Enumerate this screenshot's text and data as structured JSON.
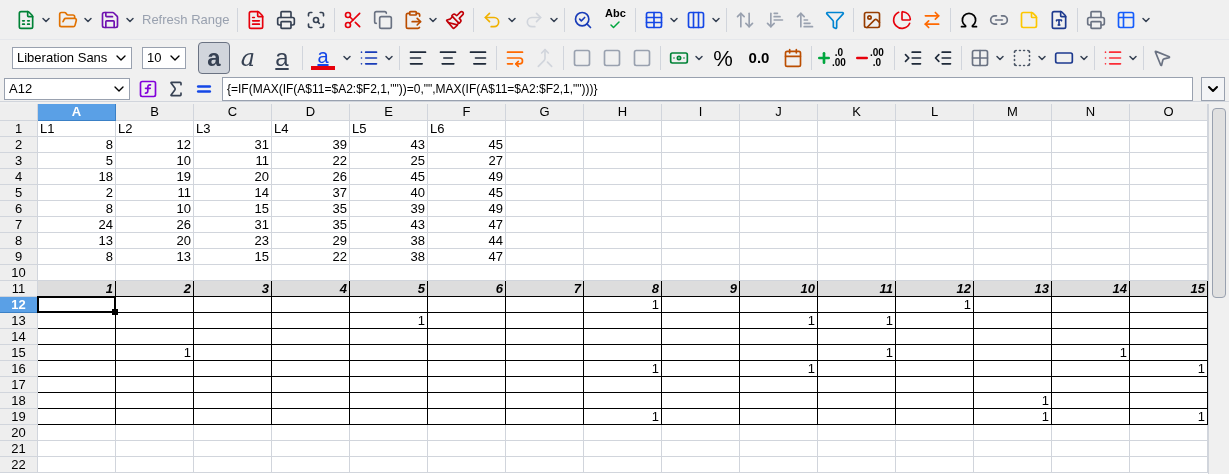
{
  "toolbar": {
    "refresh_range": {
      "label": "Refresh Range",
      "disabled": true
    },
    "spellcheck_label": "Abc",
    "percent": "%",
    "decimal": "0.0",
    "add_decimal": [
      ".0",
      ".00"
    ],
    "delete_decimal": [
      ".00",
      ".0"
    ]
  },
  "formatting": {
    "font_name": "Liberation Sans",
    "font_size": "10",
    "font_color_label": "a",
    "styles": [
      {
        "label": "a",
        "kind": "bold",
        "selected": true
      },
      {
        "label": "a",
        "kind": "italic",
        "selected": false
      },
      {
        "label": "a",
        "kind": "underline",
        "selected": false
      }
    ]
  },
  "formula_bar": {
    "name_box": "A12",
    "formula": "{=IF(MAX(IF(A$11=$A2:$F2,1,\"\"))=0,\"\",MAX(IF(A$11=$A2:$F2,1,\"\")))}"
  },
  "sheet": {
    "columns": [
      {
        "label": "A",
        "selected": true
      },
      {
        "label": "B",
        "selected": false
      },
      {
        "label": "C",
        "selected": false
      },
      {
        "label": "D",
        "selected": false
      },
      {
        "label": "E",
        "selected": false
      },
      {
        "label": "F",
        "selected": false
      },
      {
        "label": "G",
        "selected": false
      },
      {
        "label": "H",
        "selected": false
      },
      {
        "label": "I",
        "selected": false
      },
      {
        "label": "J",
        "selected": false
      },
      {
        "label": "K",
        "selected": false
      },
      {
        "label": "L",
        "selected": false
      },
      {
        "label": "M",
        "selected": false
      },
      {
        "label": "N",
        "selected": false
      },
      {
        "label": "O",
        "selected": false
      }
    ],
    "rows": [
      {
        "number": "1",
        "selected": false,
        "kind": "text",
        "cells": {
          "A": "L1",
          "B": "L2",
          "C": "L3",
          "D": "L4",
          "E": "L5",
          "F": "L6"
        }
      },
      {
        "number": "2",
        "selected": false,
        "kind": "plain",
        "cells": {
          "A": "8",
          "B": "12",
          "C": "31",
          "D": "39",
          "E": "43",
          "F": "45"
        }
      },
      {
        "number": "3",
        "selected": false,
        "kind": "plain",
        "cells": {
          "A": "5",
          "B": "10",
          "C": "11",
          "D": "22",
          "E": "25",
          "F": "27"
        }
      },
      {
        "number": "4",
        "selected": false,
        "kind": "plain",
        "cells": {
          "A": "18",
          "B": "19",
          "C": "20",
          "D": "26",
          "E": "45",
          "F": "49"
        }
      },
      {
        "number": "5",
        "selected": false,
        "kind": "plain",
        "cells": {
          "A": "2",
          "B": "11",
          "C": "14",
          "D": "37",
          "E": "40",
          "F": "45"
        }
      },
      {
        "number": "6",
        "selected": false,
        "kind": "plain",
        "cells": {
          "A": "8",
          "B": "10",
          "C": "15",
          "D": "35",
          "E": "39",
          "F": "49"
        }
      },
      {
        "number": "7",
        "selected": false,
        "kind": "plain",
        "cells": {
          "A": "24",
          "B": "26",
          "C": "31",
          "D": "35",
          "E": "43",
          "F": "47"
        }
      },
      {
        "number": "8",
        "selected": false,
        "kind": "plain",
        "cells": {
          "A": "13",
          "B": "20",
          "C": "23",
          "D": "29",
          "E": "38",
          "F": "44"
        }
      },
      {
        "number": "9",
        "selected": false,
        "kind": "plain",
        "cells": {
          "A": "8",
          "B": "13",
          "C": "15",
          "D": "22",
          "E": "38",
          "F": "47"
        }
      },
      {
        "number": "10",
        "selected": false,
        "kind": "plain",
        "cells": {}
      },
      {
        "number": "11",
        "selected": false,
        "kind": "band",
        "cells": {
          "A": "1",
          "B": "2",
          "C": "3",
          "D": "4",
          "E": "5",
          "F": "6",
          "G": "7",
          "H": "8",
          "I": "9",
          "J": "10",
          "K": "11",
          "L": "12",
          "M": "13",
          "N": "14",
          "O": "15"
        }
      },
      {
        "number": "12",
        "selected": true,
        "kind": "boxed",
        "cells": {
          "H": "1",
          "L": "1"
        }
      },
      {
        "number": "13",
        "selected": false,
        "kind": "boxed",
        "cells": {
          "E": "1",
          "J": "1",
          "K": "1"
        }
      },
      {
        "number": "14",
        "selected": false,
        "kind": "boxed",
        "cells": {}
      },
      {
        "number": "15",
        "selected": false,
        "kind": "boxed",
        "cells": {
          "B": "1",
          "K": "1",
          "N": "1"
        }
      },
      {
        "number": "16",
        "selected": false,
        "kind": "boxed",
        "cells": {
          "H": "1",
          "J": "1",
          "O": "1"
        }
      },
      {
        "number": "17",
        "selected": false,
        "kind": "boxed",
        "cells": {}
      },
      {
        "number": "18",
        "selected": false,
        "kind": "boxed",
        "cells": {
          "M": "1"
        }
      },
      {
        "number": "19",
        "selected": false,
        "kind": "boxed",
        "cells": {
          "H": "1",
          "M": "1",
          "O": "1"
        }
      },
      {
        "number": "20",
        "selected": false,
        "kind": "plain",
        "cells": {}
      },
      {
        "number": "21",
        "selected": false,
        "kind": "plain",
        "cells": {}
      },
      {
        "number": "22",
        "selected": false,
        "kind": "plain",
        "cells": {}
      }
    ]
  }
}
